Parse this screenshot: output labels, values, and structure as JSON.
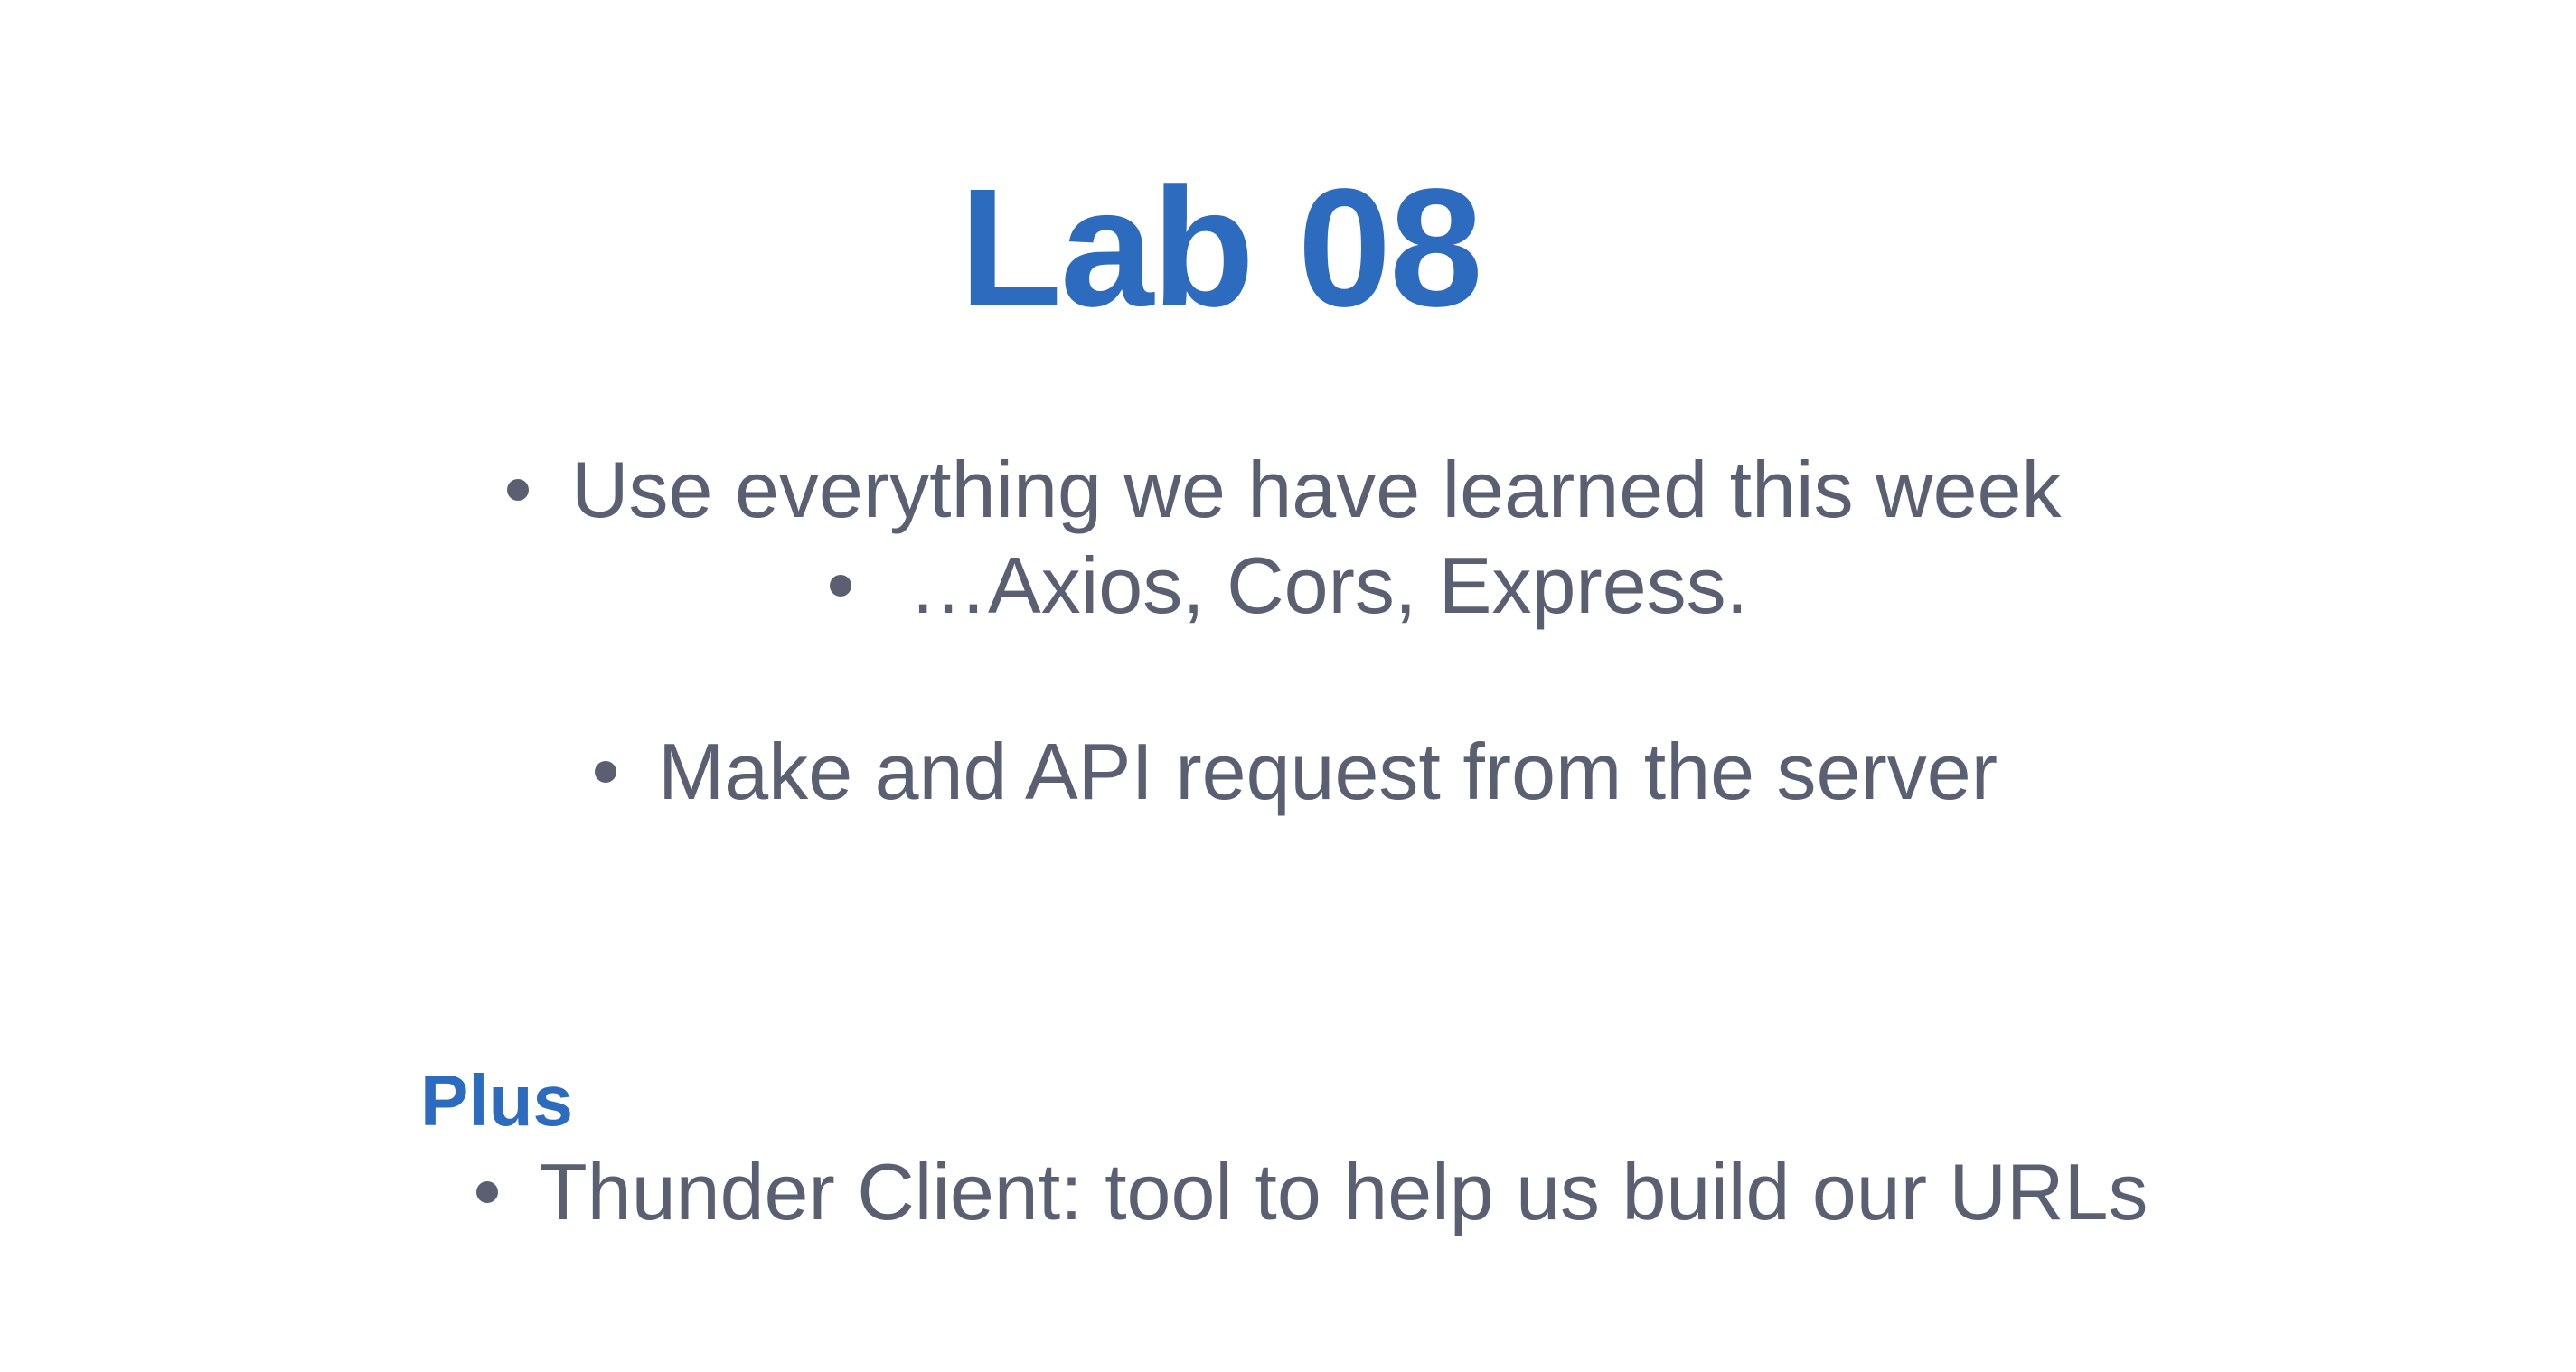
{
  "slide": {
    "title": "Lab 08",
    "bullets": [
      {
        "text": "Use everything we have learned this week"
      },
      {
        "text": "…Axios, Cors, Express."
      },
      {
        "text": "Make and API request from the server"
      }
    ],
    "plus": {
      "label": "Plus",
      "bullets": [
        {
          "text": "Thunder Client: tool to help us build our URLs"
        }
      ]
    }
  },
  "colors": {
    "title": "#2d6bbf",
    "body_text": "#5a6072",
    "background": "#ffffff"
  }
}
